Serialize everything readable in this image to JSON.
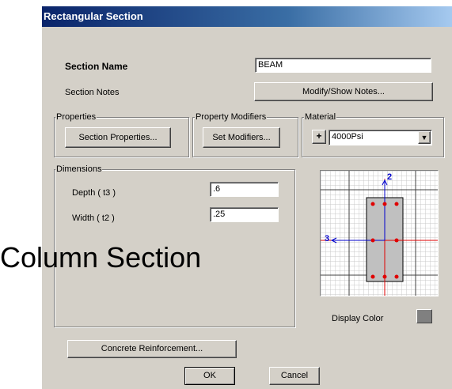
{
  "window": {
    "title": "Rectangular Section"
  },
  "section": {
    "name_label": "Section Name",
    "name_value": "BEAM",
    "notes_label": "Section Notes",
    "notes_button": "Modify/Show Notes..."
  },
  "properties": {
    "group_label": "Properties",
    "button": "Section Properties..."
  },
  "modifiers": {
    "group_label": "Property Modifiers",
    "button": "Set Modifiers..."
  },
  "material": {
    "group_label": "Material",
    "plus_icon": "+",
    "selected": "4000Psi"
  },
  "dimensions": {
    "group_label": "Dimensions",
    "depth_label": "Depth ( t3 )",
    "depth_value": ".6",
    "width_label": "Width ( t2 )",
    "width_value": ".25"
  },
  "preview": {
    "axis2_label": "2",
    "axis3_label": "3"
  },
  "display_color": {
    "label": "Display Color",
    "color": "#808080"
  },
  "buttons": {
    "reinforcement": "Concrete Reinforcement...",
    "ok": "OK",
    "cancel": "Cancel"
  },
  "overlay_text": "Column Section",
  "colors": {
    "title_start": "#0a246a",
    "title_end": "#a6caf0",
    "dialog_bg": "#d4d0c8",
    "rebar": "#e00000",
    "axis": "#0000cc",
    "section_fill": "#c0c0c0"
  }
}
